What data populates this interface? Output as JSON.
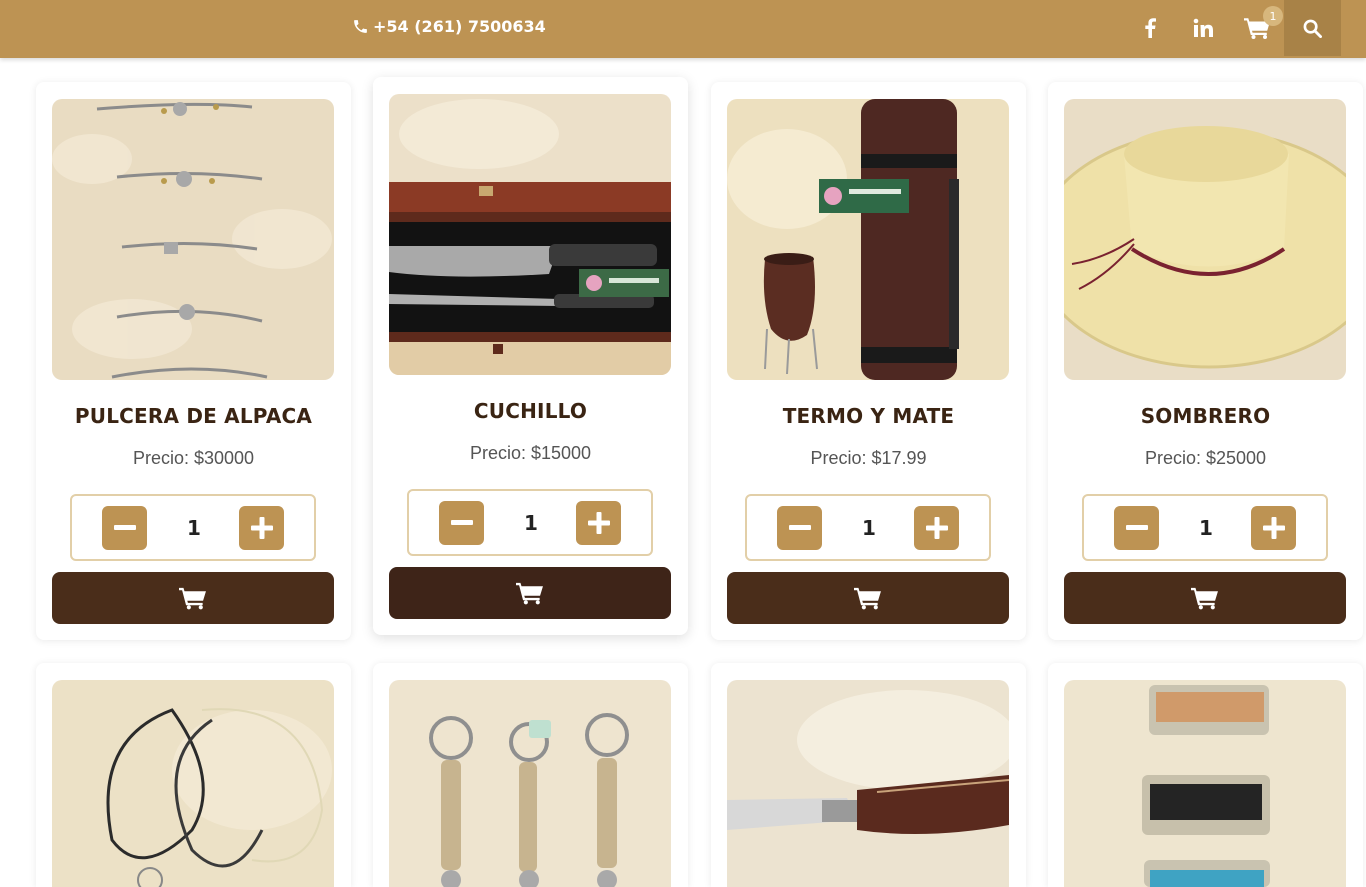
{
  "header": {
    "phone": "+54 (261) 7500634",
    "cart_count": "1",
    "icons": [
      "phone-icon",
      "facebook-icon",
      "linkedin-icon",
      "cart-icon",
      "search-icon"
    ]
  },
  "colors": {
    "brand": "#bd9353",
    "brand_dark": "#a88247",
    "cart_button": "#4a2d1a",
    "title_text": "#3a2413"
  },
  "products": [
    {
      "name": "PULCERA DE ALPACA",
      "price": "Precio: $30000",
      "qty": "1"
    },
    {
      "name": "CUCHILLO",
      "price": "Precio: $15000",
      "qty": "1"
    },
    {
      "name": "TERMO Y MATE",
      "price": "Precio: $17.99",
      "qty": "1"
    },
    {
      "name": "SOMBRERO",
      "price": "Precio: $25000",
      "qty": "1"
    },
    {
      "name": "",
      "price": "",
      "qty": ""
    },
    {
      "name": "",
      "price": "",
      "qty": ""
    },
    {
      "name": "",
      "price": "",
      "qty": ""
    },
    {
      "name": "",
      "price": "",
      "qty": ""
    }
  ]
}
